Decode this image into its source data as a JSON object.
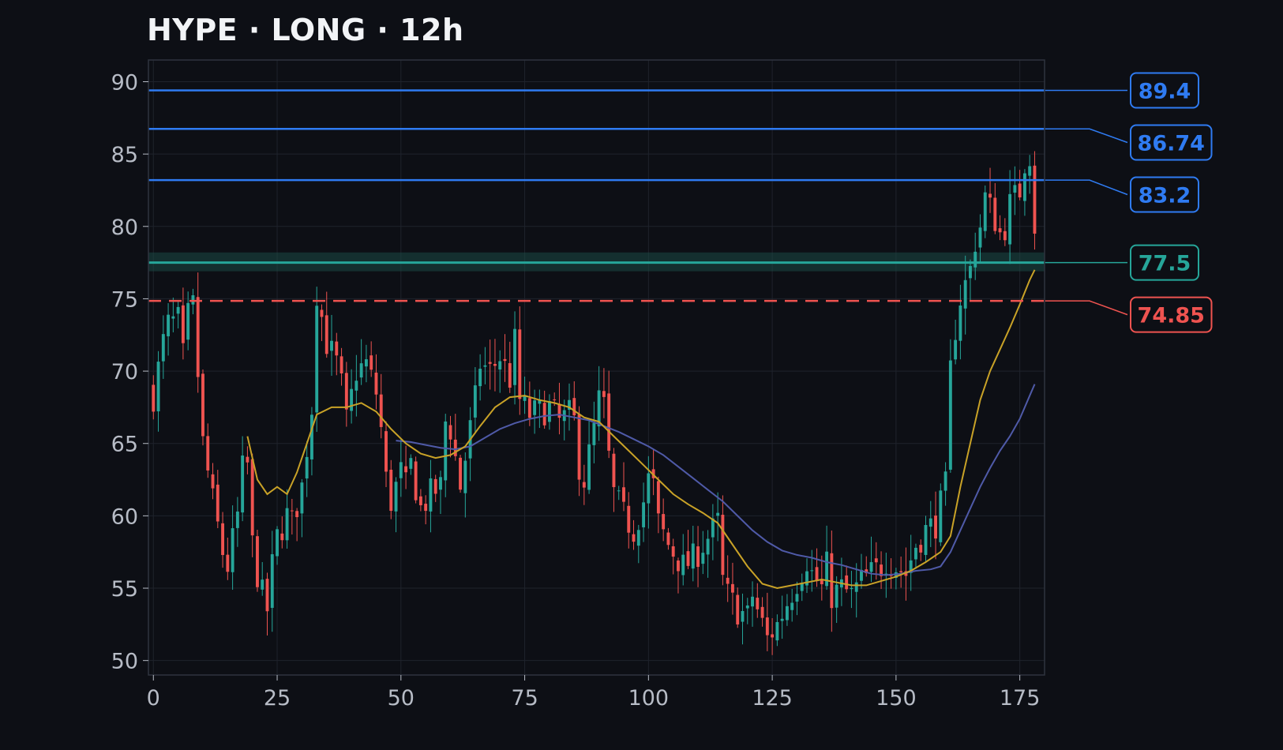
{
  "chart_data": {
    "type": "candlestick",
    "title": "HYPE · LONG · 12h",
    "xlabel": "",
    "ylabel": "",
    "xlim": [
      -1,
      180
    ],
    "ylim": [
      49,
      91.5
    ],
    "x_ticks": [
      0,
      25,
      50,
      75,
      100,
      125,
      150,
      175
    ],
    "y_ticks": [
      50,
      55,
      60,
      65,
      70,
      75,
      80,
      85,
      90
    ],
    "grid": true,
    "colors": {
      "background": "#0d0f15",
      "up": "#26a69a",
      "down": "#ef5350",
      "target": "#2f7bf2",
      "entry": "#26a69a",
      "stop": "#ef5350",
      "ma_fast": "#c9a227",
      "ma_slow": "#4f5aa8"
    },
    "levels": [
      {
        "label": "89.4",
        "value": 89.4,
        "kind": "target",
        "style": "solid"
      },
      {
        "label": "86.74",
        "value": 86.74,
        "kind": "target",
        "style": "solid"
      },
      {
        "label": "83.2",
        "value": 83.2,
        "kind": "target",
        "style": "solid"
      },
      {
        "label": "77.5",
        "value": 77.5,
        "kind": "entry",
        "style": "solid",
        "zone": [
          76.9,
          78.2
        ]
      },
      {
        "label": "74.85",
        "value": 74.85,
        "kind": "stop",
        "style": "dashed"
      }
    ],
    "anchors": [
      [
        0,
        68.3
      ],
      [
        2,
        72.0
      ],
      [
        3,
        73.2
      ],
      [
        5,
        73.5
      ],
      [
        6,
        71.0
      ],
      [
        7,
        73.8
      ],
      [
        8,
        74.5
      ],
      [
        10,
        65.0
      ],
      [
        12,
        61.0
      ],
      [
        14,
        57.5
      ],
      [
        15,
        56.5
      ],
      [
        17,
        60.0
      ],
      [
        18,
        63.2
      ],
      [
        19,
        63.5
      ],
      [
        20,
        58.0
      ],
      [
        21,
        56.0
      ],
      [
        22,
        54.5
      ],
      [
        23,
        53.5
      ],
      [
        24,
        56.5
      ],
      [
        25,
        58.5
      ],
      [
        27,
        60.0
      ],
      [
        28,
        59.5
      ],
      [
        30,
        62.0
      ],
      [
        32,
        67.5
      ],
      [
        33,
        75.5
      ],
      [
        35,
        72.0
      ],
      [
        37,
        70.5
      ],
      [
        38,
        69.0
      ],
      [
        39,
        66.5
      ],
      [
        41,
        70.0
      ],
      [
        43,
        70.5
      ],
      [
        45,
        68.5
      ],
      [
        46,
        66.0
      ],
      [
        47,
        62.5
      ],
      [
        48,
        61.0
      ],
      [
        50,
        63.0
      ],
      [
        51,
        62.0
      ],
      [
        52,
        63.5
      ],
      [
        54,
        60.5
      ],
      [
        56,
        61.5
      ],
      [
        58,
        62.0
      ],
      [
        59,
        66.5
      ],
      [
        60,
        66.0
      ],
      [
        61,
        64.0
      ],
      [
        62,
        62.0
      ],
      [
        63,
        64.0
      ],
      [
        65,
        68.0
      ],
      [
        66,
        70.5
      ],
      [
        68,
        70.0
      ],
      [
        70,
        71.0
      ],
      [
        72,
        69.5
      ],
      [
        73,
        72.0
      ],
      [
        74,
        68.0
      ],
      [
        76,
        67.0
      ],
      [
        78,
        67.2
      ],
      [
        80,
        67.5
      ],
      [
        82,
        66.5
      ],
      [
        84,
        67.0
      ],
      [
        85,
        66.5
      ],
      [
        86,
        63.5
      ],
      [
        87,
        62.5
      ],
      [
        89,
        66.0
      ],
      [
        90,
        68.0
      ],
      [
        91,
        67.5
      ],
      [
        92,
        64.0
      ],
      [
        93,
        61.5
      ],
      [
        95,
        60.0
      ],
      [
        97,
        59.0
      ],
      [
        99,
        61.0
      ],
      [
        100,
        62.5
      ],
      [
        101,
        62.0
      ],
      [
        102,
        59.5
      ],
      [
        104,
        58.0
      ],
      [
        105,
        57.5
      ],
      [
        107,
        56.5
      ],
      [
        109,
        57.0
      ],
      [
        111,
        58.0
      ],
      [
        113,
        59.0
      ],
      [
        114,
        59.5
      ],
      [
        115,
        55.5
      ],
      [
        116,
        54.5
      ],
      [
        118,
        53.5
      ],
      [
        120,
        53.0
      ],
      [
        121,
        54.5
      ],
      [
        123,
        52.5
      ],
      [
        124,
        51.5
      ],
      [
        126,
        52.5
      ],
      [
        128,
        54.0
      ],
      [
        130,
        55.5
      ],
      [
        132,
        57.0
      ],
      [
        133,
        56.0
      ],
      [
        135,
        55.0
      ],
      [
        136,
        56.5
      ],
      [
        137,
        54.5
      ],
      [
        139,
        55.0
      ],
      [
        141,
        54.5
      ],
      [
        143,
        55.5
      ],
      [
        145,
        56.0
      ],
      [
        147,
        56.5
      ],
      [
        148,
        57.0
      ],
      [
        150,
        56.5
      ],
      [
        152,
        56.0
      ],
      [
        154,
        58.0
      ],
      [
        156,
        59.0
      ],
      [
        158,
        59.5
      ],
      [
        160,
        62.0
      ],
      [
        161,
        70.0
      ],
      [
        162,
        73.0
      ],
      [
        163,
        75.0
      ],
      [
        165,
        77.0
      ],
      [
        166,
        79.0
      ],
      [
        167,
        80.0
      ],
      [
        168,
        82.0
      ],
      [
        170,
        80.5
      ],
      [
        171,
        79.5
      ],
      [
        172,
        80.0
      ],
      [
        173,
        81.5
      ],
      [
        174,
        82.0
      ],
      [
        175,
        82.5
      ],
      [
        176,
        84.5
      ],
      [
        177,
        85.0
      ],
      [
        178,
        79.5
      ]
    ],
    "ma_fast_points": [
      [
        19,
        65.5
      ],
      [
        21,
        62.5
      ],
      [
        23,
        61.5
      ],
      [
        25,
        62.0
      ],
      [
        27,
        61.5
      ],
      [
        29,
        63.0
      ],
      [
        31,
        65.0
      ],
      [
        33,
        67.0
      ],
      [
        36,
        67.5
      ],
      [
        39,
        67.5
      ],
      [
        42,
        67.8
      ],
      [
        45,
        67.2
      ],
      [
        48,
        66.0
      ],
      [
        51,
        65.0
      ],
      [
        54,
        64.3
      ],
      [
        57,
        64.0
      ],
      [
        60,
        64.2
      ],
      [
        63,
        64.8
      ],
      [
        66,
        66.2
      ],
      [
        69,
        67.5
      ],
      [
        72,
        68.2
      ],
      [
        75,
        68.3
      ],
      [
        78,
        68.0
      ],
      [
        81,
        67.8
      ],
      [
        84,
        67.5
      ],
      [
        87,
        66.8
      ],
      [
        90,
        66.5
      ],
      [
        93,
        65.5
      ],
      [
        96,
        64.5
      ],
      [
        99,
        63.5
      ],
      [
        102,
        62.5
      ],
      [
        105,
        61.5
      ],
      [
        108,
        60.8
      ],
      [
        111,
        60.2
      ],
      [
        114,
        59.5
      ],
      [
        117,
        58.0
      ],
      [
        120,
        56.5
      ],
      [
        123,
        55.3
      ],
      [
        126,
        55.0
      ],
      [
        129,
        55.2
      ],
      [
        132,
        55.4
      ],
      [
        135,
        55.6
      ],
      [
        138,
        55.4
      ],
      [
        141,
        55.2
      ],
      [
        144,
        55.2
      ],
      [
        147,
        55.5
      ],
      [
        150,
        55.8
      ],
      [
        153,
        56.2
      ],
      [
        156,
        56.8
      ],
      [
        159,
        57.5
      ],
      [
        161,
        58.6
      ],
      [
        163,
        62.0
      ],
      [
        165,
        65.0
      ],
      [
        167,
        68.0
      ],
      [
        169,
        70.0
      ],
      [
        171,
        71.5
      ],
      [
        173,
        73.0
      ],
      [
        175,
        74.6
      ],
      [
        177,
        76.3
      ],
      [
        178,
        77.0
      ]
    ],
    "ma_slow_points": [
      [
        49,
        65.2
      ],
      [
        52,
        65.1
      ],
      [
        55,
        64.9
      ],
      [
        58,
        64.7
      ],
      [
        61,
        64.6
      ],
      [
        64,
        64.8
      ],
      [
        67,
        65.4
      ],
      [
        70,
        66.0
      ],
      [
        73,
        66.4
      ],
      [
        76,
        66.7
      ],
      [
        79,
        66.9
      ],
      [
        82,
        67.0
      ],
      [
        85,
        66.8
      ],
      [
        88,
        66.6
      ],
      [
        91,
        66.2
      ],
      [
        94,
        65.8
      ],
      [
        97,
        65.3
      ],
      [
        100,
        64.8
      ],
      [
        103,
        64.2
      ],
      [
        106,
        63.4
      ],
      [
        109,
        62.6
      ],
      [
        112,
        61.8
      ],
      [
        115,
        61.0
      ],
      [
        118,
        60.0
      ],
      [
        121,
        59.0
      ],
      [
        124,
        58.2
      ],
      [
        127,
        57.6
      ],
      [
        130,
        57.3
      ],
      [
        133,
        57.1
      ],
      [
        136,
        56.8
      ],
      [
        139,
        56.6
      ],
      [
        142,
        56.3
      ],
      [
        145,
        56.0
      ],
      [
        148,
        55.9
      ],
      [
        151,
        56.0
      ],
      [
        154,
        56.2
      ],
      [
        157,
        56.3
      ],
      [
        159,
        56.5
      ],
      [
        161,
        57.5
      ],
      [
        163,
        59.0
      ],
      [
        165,
        60.5
      ],
      [
        167,
        62.0
      ],
      [
        169,
        63.3
      ],
      [
        171,
        64.5
      ],
      [
        173,
        65.5
      ],
      [
        175,
        66.7
      ],
      [
        177,
        68.3
      ],
      [
        178,
        69.1
      ]
    ]
  }
}
